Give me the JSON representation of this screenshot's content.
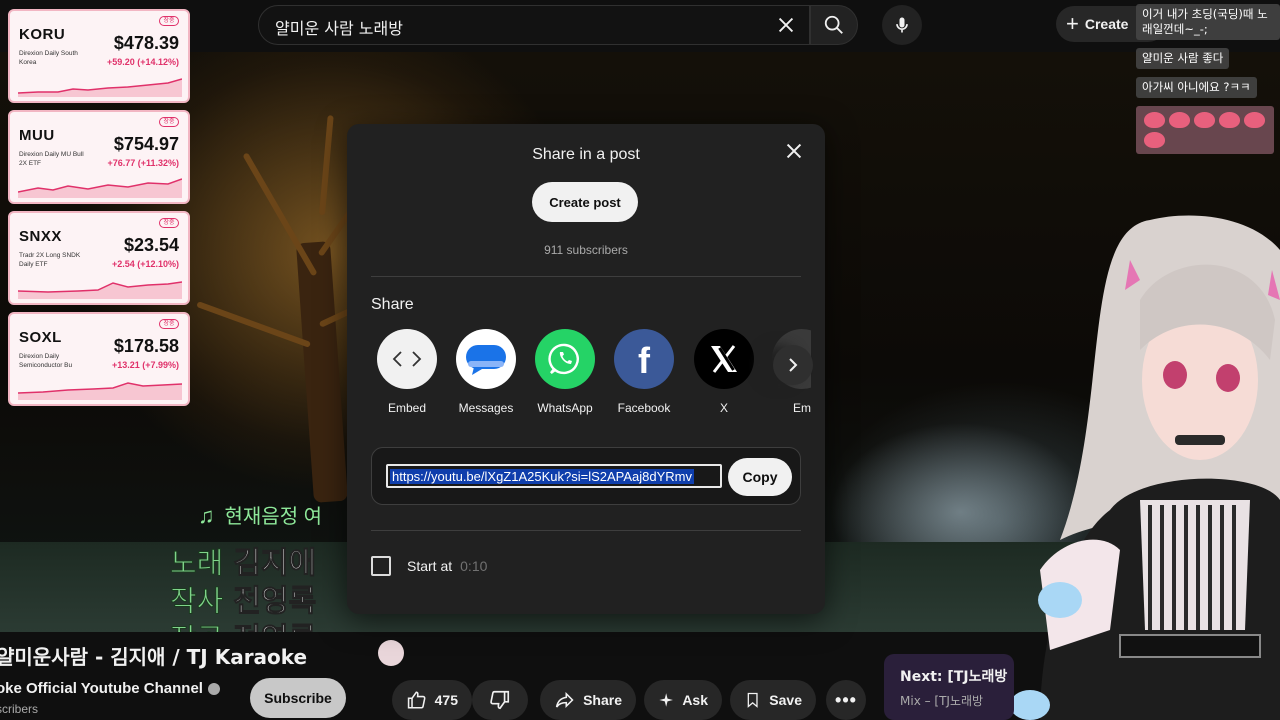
{
  "search": {
    "query": "얄미운 사람 노래방"
  },
  "topbar": {
    "create_label": "Create"
  },
  "stocks": [
    {
      "ticker": "KORU",
      "desc": "Direxion Daily South Korea",
      "price": "$478.39",
      "change": "+59.20 (+14.12%)",
      "badge": "장중"
    },
    {
      "ticker": "MUU",
      "desc": "Direxion Daily MU Bull 2X ETF",
      "price": "$754.97",
      "change": "+76.77 (+11.32%)",
      "badge": "장중"
    },
    {
      "ticker": "SNXX",
      "desc": "Tradr 2X Long SNDK Daily ETF",
      "price": "$23.54",
      "change": "+2.54 (+12.10%)",
      "badge": "장중"
    },
    {
      "ticker": "SOXL",
      "desc": "Direxion Daily Semiconductor Bu",
      "price": "$178.58",
      "change": "+13.21 (+7.99%)",
      "badge": "장중"
    }
  ],
  "chat": [
    {
      "text": "이거 내가 초딩(국딩)때 노래일껀데~_-;"
    },
    {
      "text": "얄미운 사람 좋다"
    },
    {
      "text": "아가씨 아니에요 ?ㅋㅋ"
    }
  ],
  "lyrics": {
    "now_playing": "현재음정 여",
    "rows": [
      {
        "key": "노래",
        "value": "김지애"
      },
      {
        "key": "작사",
        "value": "전영록"
      },
      {
        "key": "작곡",
        "value": "전영록"
      }
    ]
  },
  "video": {
    "title": "얄미운사람 - 김지애 / TJ Karaoke",
    "channel": "oke Official Youtube Channel",
    "subscribers": "scribers",
    "subscribe_label": "Subscribe",
    "likes": "475",
    "share_label": "Share",
    "ask_label": "Ask",
    "save_label": "Save"
  },
  "next_card": {
    "title": "Next: [TJ노래방",
    "subtitle": "Mix – [TJ노래방"
  },
  "modal": {
    "title": "Share in a post",
    "create_post_label": "Create post",
    "subscribers": "911 subscribers",
    "share_heading": "Share",
    "targets": [
      {
        "label": "Embed",
        "icon": "embed-icon",
        "color": "#f1f1f1"
      },
      {
        "label": "Messages",
        "icon": "messages-icon",
        "color": "#ffffff"
      },
      {
        "label": "WhatsApp",
        "icon": "whatsapp-icon",
        "color": "#25d366"
      },
      {
        "label": "Facebook",
        "icon": "facebook-icon",
        "color": "#3b5998"
      },
      {
        "label": "X",
        "icon": "x-icon",
        "color": "#000000"
      },
      {
        "label": "Em",
        "icon": "email-icon",
        "color": "#3a3a3a"
      }
    ],
    "link": "https://youtu.be/lXgZ1A25Kuk?si=lS2APAaj8dYRmv",
    "copy_label": "Copy",
    "start_at_label": "Start at",
    "start_at_time": "0:10"
  },
  "colors": {
    "accent_selection": "#0f3eac",
    "modal_bg": "#212121",
    "stock_red": "#e0316a"
  }
}
